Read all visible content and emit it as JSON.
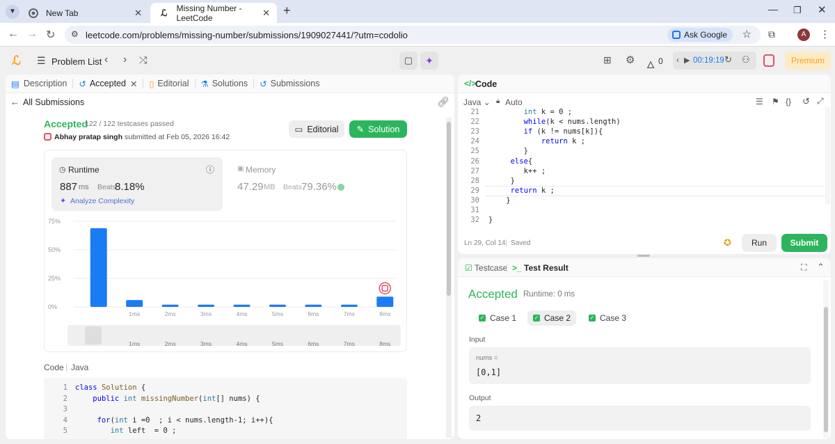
{
  "browser": {
    "tabs": [
      {
        "title": "New Tab"
      },
      {
        "title": "Missing Number - LeetCode"
      }
    ],
    "url": "leetcode.com/problems/missing-number/submissions/1909027441/?utm=codolio",
    "ask_google": "Ask Google",
    "profile_initial": "A"
  },
  "topnav": {
    "problem_list": "Problem List",
    "fire_count": "0",
    "timer": "00:19:19",
    "premium": "Premium"
  },
  "left_tabs": [
    {
      "label": "Description"
    },
    {
      "label": "Accepted"
    },
    {
      "label": "Editorial"
    },
    {
      "label": "Solutions"
    },
    {
      "label": "Submissions"
    }
  ],
  "submission": {
    "back_label": "All Submissions",
    "status": "Accepted",
    "testcases": "122 / 122 testcases passed",
    "user": "Abhay pratap singh",
    "submitted_at": "submitted at Feb 05, 2026 16:42",
    "editorial_button": "Editorial",
    "solution_button": "Solution",
    "runtime_label": "Runtime",
    "runtime_value": "887",
    "runtime_unit": "ms",
    "beats_label": "Beats",
    "runtime_beats": "8.18%",
    "analyze": "Analyze Complexity",
    "memory_label": "Memory",
    "memory_value": "47.29",
    "memory_unit": "MB",
    "memory_beats": "79.36%",
    "code_label": "Code",
    "code_lang": "Java"
  },
  "chart_data": {
    "type": "bar",
    "y_ticks": [
      "75%",
      "50%",
      "25%",
      "0%"
    ],
    "ylim": [
      0,
      75
    ],
    "categories": [
      "",
      "1ms",
      "2ms",
      "3ms",
      "4ms",
      "5ms",
      "6ms",
      "7ms",
      "8ms"
    ],
    "values": [
      69,
      6,
      2,
      2,
      2,
      2,
      2,
      2,
      9
    ],
    "range_labels": [
      "1ms",
      "2ms",
      "3ms",
      "4ms",
      "5ms",
      "6ms",
      "7ms",
      "8ms"
    ],
    "colors": {
      "bar": "#1a7cf5"
    }
  },
  "submitted_code": [
    {
      "n": "1",
      "text": "class Solution {"
    },
    {
      "n": "2",
      "text": "    public int missingNumber(int[] nums) {"
    },
    {
      "n": "3",
      "text": ""
    },
    {
      "n": "4",
      "text": "     for(int i =0  ; i < nums.length-1; i++){"
    },
    {
      "n": "5",
      "text": "        int left  = 0 ;"
    }
  ],
  "editor": {
    "title": "Code",
    "lang": "Java",
    "mode": "Auto",
    "lines": [
      {
        "n": "21",
        "text": "        int k = 0 ;"
      },
      {
        "n": "22",
        "text": "        while(k < nums.length)"
      },
      {
        "n": "23",
        "text": "        if (k != nums[k]){"
      },
      {
        "n": "24",
        "text": "            return k ;"
      },
      {
        "n": "25",
        "text": "        }"
      },
      {
        "n": "26",
        "text": "     else{"
      },
      {
        "n": "27",
        "text": "        k++ ;"
      },
      {
        "n": "28",
        "text": "     }"
      },
      {
        "n": "29",
        "text": "     return k ;"
      },
      {
        "n": "30",
        "text": "    }"
      },
      {
        "n": "31",
        "text": ""
      },
      {
        "n": "32",
        "text": "}"
      }
    ],
    "cursor": "Ln 29, Col 14",
    "saved": "Saved",
    "run": "Run",
    "submit": "Submit"
  },
  "result": {
    "testcase_tab": "Testcase",
    "result_tab": "Test Result",
    "status": "Accepted",
    "runtime": "Runtime: 0 ms",
    "cases": [
      "Case 1",
      "Case 2",
      "Case 3"
    ],
    "input_label": "Input",
    "input_var": "nums =",
    "input_value": "[0,1]",
    "output_label": "Output",
    "output_value": "2"
  }
}
